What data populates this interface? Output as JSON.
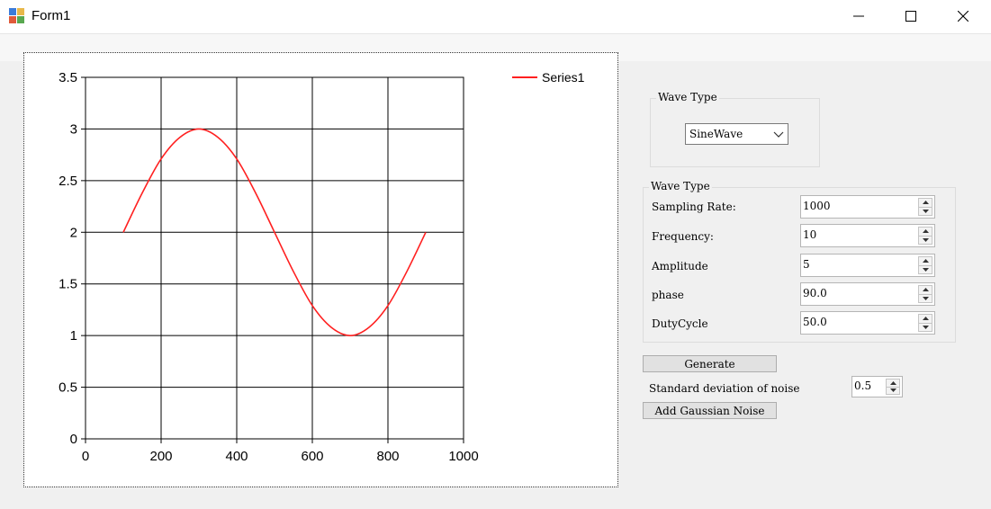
{
  "window": {
    "title": "Form1"
  },
  "chart": {
    "legend": {
      "label": "Series1",
      "color": "#ff2020"
    },
    "x_ticks": [
      "0",
      "200",
      "400",
      "600",
      "800",
      "1000"
    ],
    "y_ticks": [
      "0",
      "0.5",
      "1",
      "1.5",
      "2",
      "2.5",
      "3",
      "3.5"
    ]
  },
  "chart_data": {
    "type": "line",
    "title": "",
    "xlabel": "",
    "ylabel": "",
    "xlim": [
      0,
      1000
    ],
    "ylim": [
      0,
      3.5
    ],
    "grid": true,
    "legend_position": "top-right",
    "series": [
      {
        "name": "Series1",
        "color": "#ff2020",
        "x": [
          100,
          150,
          200,
          250,
          300,
          350,
          400,
          450,
          500,
          550,
          600,
          650,
          700,
          750,
          800,
          850,
          900
        ],
        "y": [
          2,
          2.38,
          2.71,
          2.92,
          3,
          2.92,
          2.71,
          2.38,
          2,
          1.62,
          1.29,
          1.08,
          1,
          1.08,
          1.29,
          1.62,
          2
        ]
      }
    ]
  },
  "wave_type_group": {
    "title": "Wave Type",
    "selected": "SineWave"
  },
  "params_group": {
    "title": "Wave Type",
    "fields": [
      {
        "label": "Sampling Rate:",
        "value": "1000"
      },
      {
        "label": "Frequency:",
        "value": "10"
      },
      {
        "label": "Amplitude",
        "value": "5"
      },
      {
        "label": "phase",
        "value": "90.0"
      },
      {
        "label": "DutyCycle",
        "value": "50.0"
      }
    ]
  },
  "generate_label": "Generate",
  "noise": {
    "label": "Standard deviation of noise",
    "value": "0.5",
    "button_label": "Add Gaussian Noise"
  }
}
